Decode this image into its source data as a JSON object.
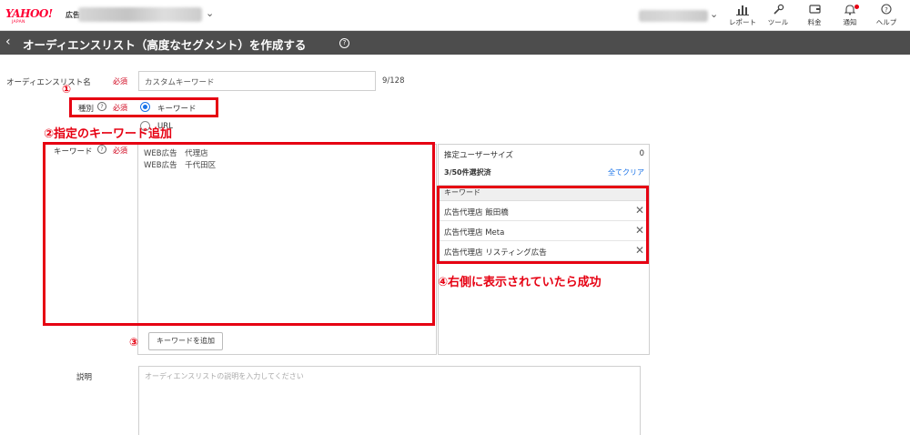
{
  "header": {
    "logo_text": "YAHOO!",
    "logo_sub": "JAPAN",
    "logo_suffix": "広告",
    "nav": [
      {
        "label": "レポート",
        "icon": "bar-chart-icon"
      },
      {
        "label": "ツール",
        "icon": "wrench-icon"
      },
      {
        "label": "料金",
        "icon": "wallet-icon"
      },
      {
        "label": "通知",
        "icon": "bell-icon"
      },
      {
        "label": "ヘルプ",
        "icon": "question-circle-icon"
      }
    ]
  },
  "title_bar": {
    "title": "オーディエンスリスト（高度なセグメント）を作成する",
    "help_glyph": "?"
  },
  "form": {
    "name": {
      "label": "オーディエンスリスト名",
      "required": "必須",
      "value": "カスタムキーワード",
      "counter": "9/128"
    },
    "type": {
      "label": "種別",
      "required": "必須",
      "help": "?",
      "options": [
        {
          "label": "キーワード",
          "selected": true
        },
        {
          "label": "URL",
          "selected": false
        }
      ]
    },
    "keyword": {
      "label": "キーワード",
      "required": "必須",
      "help": "?",
      "lines": [
        "WEB広告　代理店",
        "WEB広告　千代田区"
      ],
      "add_button": "キーワードを追加"
    },
    "panel": {
      "estimate_label": "推定ユーザーサイズ",
      "estimate_value": "0",
      "selected_count": "3/50件選択済",
      "clear_all": "全てクリア",
      "column_header": "キーワード",
      "items": [
        "広告代理店 飯田橋",
        "広告代理店 Meta",
        "広告代理店 リスティング広告"
      ],
      "remove_glyph": "✕"
    },
    "description": {
      "label": "説明",
      "placeholder": "オーディエンスリストの説明を入力してください"
    }
  },
  "annotations": {
    "a1": "①",
    "a2": "②指定のキーワード追加",
    "a3": "③",
    "a4": "④右側に表示されていたら成功"
  },
  "colors": {
    "accent": "#1a73e8",
    "required": "#d0021b",
    "annotation": "#e60012",
    "title_bar": "#4d4d4d"
  }
}
